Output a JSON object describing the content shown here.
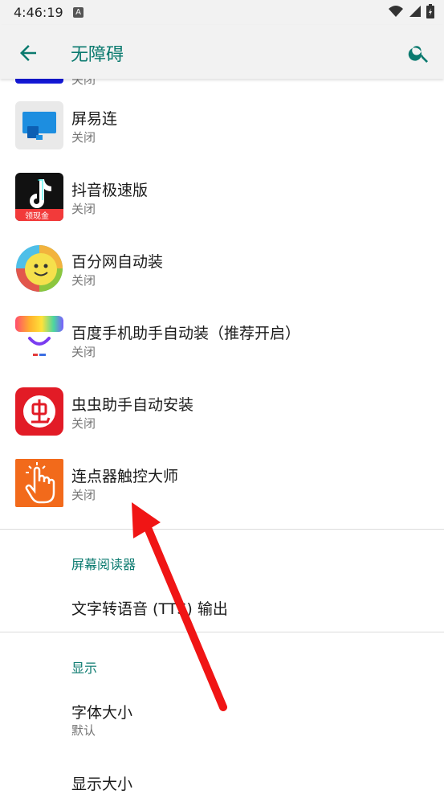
{
  "status_bar": {
    "time": "4:46:19",
    "notification_badge": "A",
    "icons": [
      "wifi-icon",
      "signal-icon",
      "battery-icon"
    ]
  },
  "app_bar": {
    "title": "无障碍",
    "back_icon": "arrow-left-icon",
    "search_icon": "search-icon",
    "accent_color": "#0b7a6f"
  },
  "partial_item": {
    "subtitle": "关闭"
  },
  "apps": [
    {
      "name": "屏易连",
      "status": "关闭",
      "icon": "screen-cast-icon"
    },
    {
      "name": "抖音极速版",
      "status": "关闭",
      "icon": "douyin-lite-icon",
      "icon_badge": "领现金"
    },
    {
      "name": "百分网自动装",
      "status": "关闭",
      "icon": "smiley-icon"
    },
    {
      "name": "百度手机助手自动装（推荐开启）",
      "status": "关闭",
      "icon": "baidu-assistant-icon"
    },
    {
      "name": "虫虫助手自动安装",
      "status": "关闭",
      "icon": "chongchong-icon"
    },
    {
      "name": "连点器触控大师",
      "status": "关闭",
      "icon": "tap-hand-icon"
    }
  ],
  "screen_reader": {
    "header": "屏幕阅读器",
    "items": [
      {
        "title": "文字转语音 (TTS) 输出"
      }
    ]
  },
  "display": {
    "header": "显示",
    "items": [
      {
        "title": "字体大小",
        "subtitle": "默认"
      },
      {
        "title": "显示大小"
      }
    ]
  },
  "annotation": {
    "arrow_color": "#f01515"
  }
}
